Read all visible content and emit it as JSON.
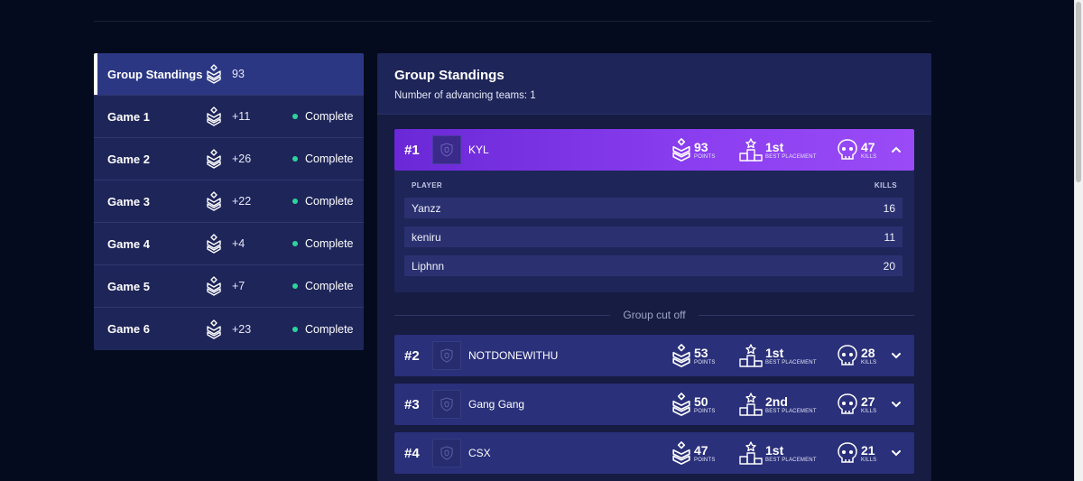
{
  "sidebar": {
    "items": [
      {
        "name": "Group Standings",
        "points": "93",
        "status": ""
      },
      {
        "name": "Game 1",
        "points": "+11",
        "status": "Complete"
      },
      {
        "name": "Game 2",
        "points": "+26",
        "status": "Complete"
      },
      {
        "name": "Game 3",
        "points": "+22",
        "status": "Complete"
      },
      {
        "name": "Game 4",
        "points": "+4",
        "status": "Complete"
      },
      {
        "name": "Game 5",
        "points": "+7",
        "status": "Complete"
      },
      {
        "name": "Game 6",
        "points": "+23",
        "status": "Complete"
      }
    ]
  },
  "main": {
    "title": "Group Standings",
    "subtitle": "Number of advancing teams: 1",
    "labels": {
      "points": "POINTS",
      "best_placement": "BEST PLACEMENT",
      "kills": "KILLS",
      "player_col": "PLAYER",
      "kills_col": "KILLS",
      "cutoff": "Group cut off"
    },
    "teams": [
      {
        "rank": "#1",
        "name": "KYL",
        "points": "93",
        "best": "1st",
        "kills": "47"
      },
      {
        "rank": "#2",
        "name": "NOTDONEWITHU",
        "points": "53",
        "best": "1st",
        "kills": "28"
      },
      {
        "rank": "#3",
        "name": "Gang Gang",
        "points": "50",
        "best": "2nd",
        "kills": "27"
      },
      {
        "rank": "#4",
        "name": "CSX",
        "points": "47",
        "best": "1st",
        "kills": "21"
      }
    ],
    "players": [
      {
        "name": "Yanzz",
        "kills": "16"
      },
      {
        "name": "keniru",
        "kills": "11"
      },
      {
        "name": "Liphnn",
        "kills": "20"
      }
    ]
  },
  "colors": {
    "background": "#050b1e",
    "panel": "#1e2559",
    "active_row": "#8b3ff0",
    "status_dot": "#2ed39e"
  }
}
